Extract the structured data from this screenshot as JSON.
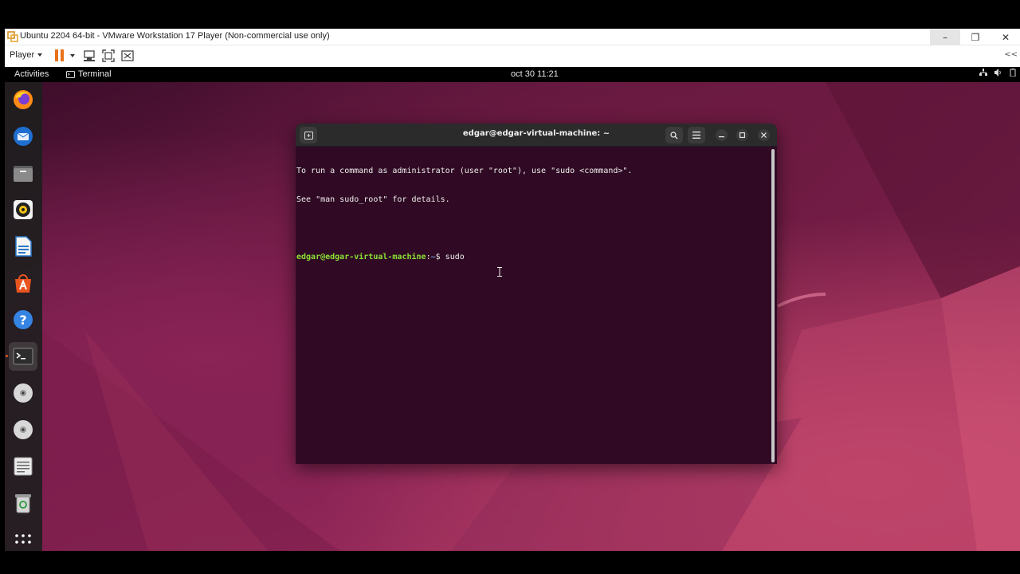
{
  "vmware": {
    "title": "Ubuntu 2204 64-bit - VMware Workstation 17 Player (Non-commercial use only)",
    "player_menu": "Player",
    "window_controls": {
      "minimize": "–",
      "restore": "❐",
      "close": "✕"
    },
    "toolbar_overflow": "<<",
    "accent_pause": "#e8711a"
  },
  "gnome": {
    "activities": "Activities",
    "app_name": "Terminal",
    "clock": "oct 30  11:21"
  },
  "dock": {
    "items": [
      {
        "name": "firefox",
        "icon": "firefox-icon"
      },
      {
        "name": "thunderbird",
        "icon": "thunderbird-icon"
      },
      {
        "name": "files",
        "icon": "files-icon"
      },
      {
        "name": "rhythmbox",
        "icon": "rhythmbox-icon"
      },
      {
        "name": "libreoffice-writer",
        "icon": "writer-icon"
      },
      {
        "name": "ubuntu-software",
        "icon": "software-icon"
      },
      {
        "name": "help",
        "icon": "help-icon"
      },
      {
        "name": "terminal",
        "icon": "terminal-icon"
      },
      {
        "name": "cd-drive-1",
        "icon": "disc-icon"
      },
      {
        "name": "cd-drive-2",
        "icon": "disc-icon"
      },
      {
        "name": "text-editor",
        "icon": "text-editor-icon"
      },
      {
        "name": "trash",
        "icon": "trash-icon"
      },
      {
        "name": "show-apps",
        "icon": "apps-grid-icon"
      }
    ]
  },
  "terminal": {
    "title": "edgar@edgar-virtual-machine: ~",
    "lines": [
      "To run a command as administrator (user \"root\"), use \"sudo <command>\".",
      "See \"man sudo_root\" for details."
    ],
    "prompt_user": "edgar@edgar-virtual-machine",
    "prompt_sep": ":",
    "prompt_path": "~",
    "prompt_symbol": "$ ",
    "current_input": "sudo",
    "background": "#300a24",
    "prompt_color": "#8ae234"
  }
}
